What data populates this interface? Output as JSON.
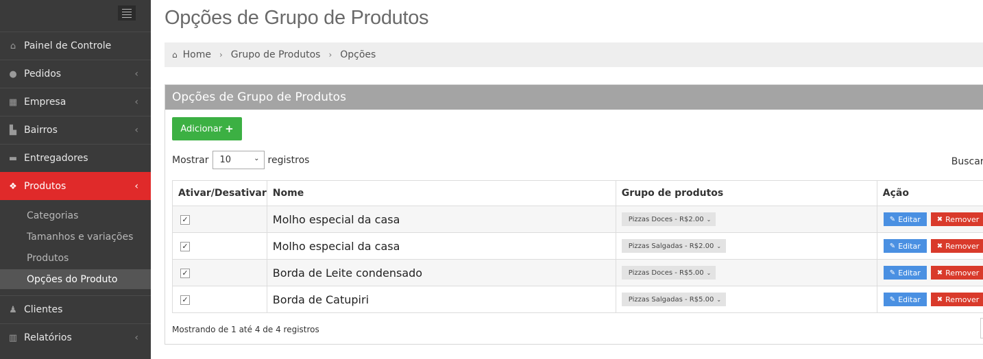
{
  "sidebar": {
    "items": [
      {
        "label": "Painel de Controle",
        "icon": "home-icon",
        "has_chevron": false
      },
      {
        "label": "Pedidos",
        "icon": "users-icon",
        "has_chevron": true
      },
      {
        "label": "Empresa",
        "icon": "building-icon",
        "has_chevron": true
      },
      {
        "label": "Bairros",
        "icon": "cart-icon",
        "has_chevron": true
      },
      {
        "label": "Entregadores",
        "icon": "truck-icon",
        "has_chevron": false
      },
      {
        "label": "Produtos",
        "icon": "dropbox-icon",
        "has_chevron": true,
        "active": true
      },
      {
        "label": "Clientes",
        "icon": "user-icon",
        "has_chevron": false
      },
      {
        "label": "Relatórios",
        "icon": "bar-chart-icon",
        "has_chevron": true
      }
    ],
    "submenu": [
      {
        "label": "Categorias"
      },
      {
        "label": "Tamanhos e variações"
      },
      {
        "label": "Produtos"
      },
      {
        "label": "Opções do Produto",
        "active": true
      }
    ],
    "active_color": "#e02a2a"
  },
  "page": {
    "title": "Opções de Grupo de Produtos"
  },
  "breadcrumb": [
    "Home",
    "Grupo de Produtos",
    "Opções"
  ],
  "panel": {
    "title": "Opções de Grupo de Produtos",
    "add_label": "Adicionar",
    "show_label": "Mostrar",
    "page_size": "10",
    "records_label": "registros",
    "search_label": "Buscar:",
    "footer": "Mostrando de 1 até 4 de 4 registros"
  },
  "table": {
    "columns": [
      "Ativar/Desativar",
      "Nome",
      "Grupo de produtos",
      "Ação"
    ],
    "rows": [
      {
        "active": true,
        "name": "Molho especial da casa",
        "group": "Pizzas Doces - R$2.00"
      },
      {
        "active": true,
        "name": "Molho especial da casa",
        "group": "Pizzas Salgadas - R$2.00"
      },
      {
        "active": true,
        "name": "Borda de Leite condensado",
        "group": "Pizzas Doces - R$5.00"
      },
      {
        "active": true,
        "name": "Borda de Catupiri",
        "group": "Pizzas Salgadas - R$5.00"
      }
    ],
    "edit_label": "Editar",
    "remove_label": "Remover"
  }
}
